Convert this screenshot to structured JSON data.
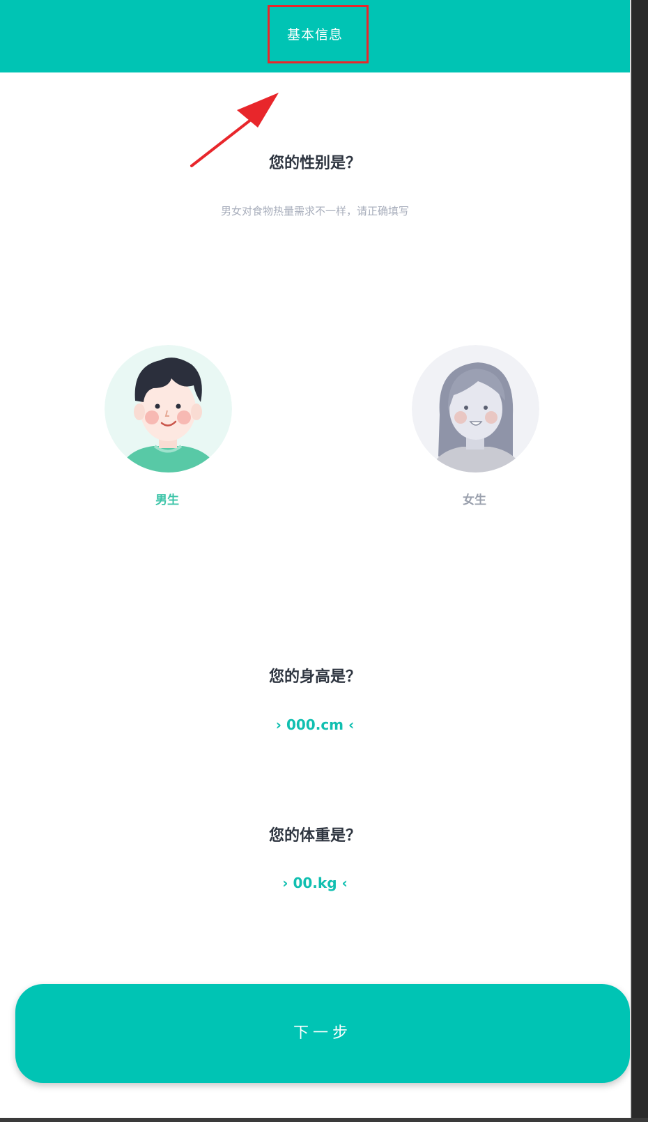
{
  "header": {
    "title": "基本信息"
  },
  "gender_section": {
    "question": "您的性别是？",
    "subtitle": "男女对食物热量需求不一样，请正确填写",
    "options": [
      {
        "label": "男生",
        "color": "#3cc4a8"
      },
      {
        "label": "女生",
        "color": "#9aa0ad"
      }
    ]
  },
  "height_section": {
    "question": "您的身高是？",
    "value": "› 000.cm ‹"
  },
  "weight_section": {
    "question": "您的体重是？",
    "value": "› 00.kg ‹"
  },
  "footer": {
    "next_label": "下一步"
  },
  "colors": {
    "brand": "#00c4b4",
    "annotation": "#e8262b",
    "title_text": "#2e3540",
    "subtitle_text": "#a7adbb"
  }
}
